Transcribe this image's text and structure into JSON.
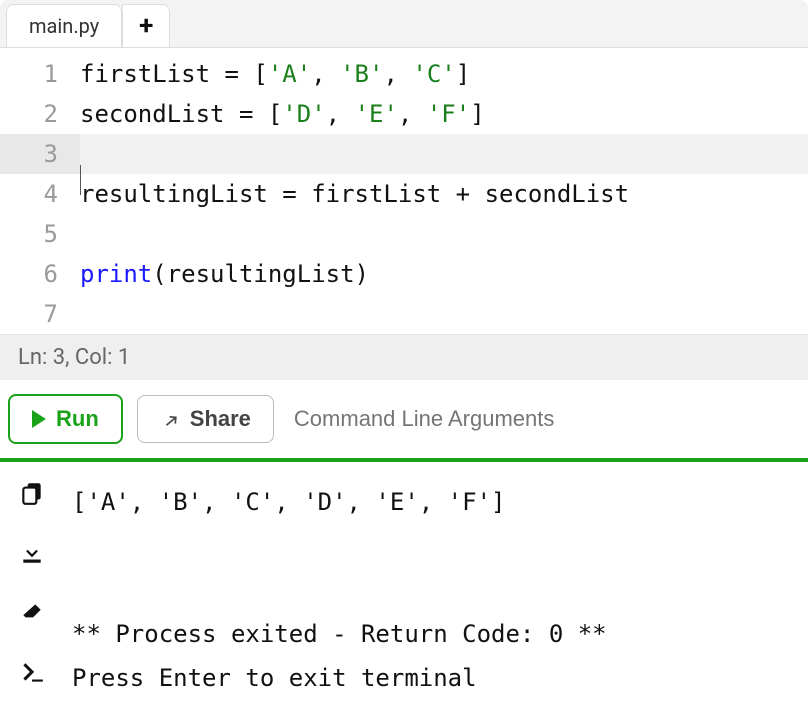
{
  "tabs": {
    "active": "main.py"
  },
  "editor": {
    "lines": [
      {
        "n": 1,
        "tokens": [
          {
            "t": "firstList = ["
          },
          {
            "t": "'A'",
            "c": "tok-str"
          },
          {
            "t": ", "
          },
          {
            "t": "'B'",
            "c": "tok-str"
          },
          {
            "t": ", "
          },
          {
            "t": "'C'",
            "c": "tok-str"
          },
          {
            "t": "]"
          }
        ]
      },
      {
        "n": 2,
        "tokens": [
          {
            "t": "secondList = ["
          },
          {
            "t": "'D'",
            "c": "tok-str"
          },
          {
            "t": ", "
          },
          {
            "t": "'E'",
            "c": "tok-str"
          },
          {
            "t": ", "
          },
          {
            "t": "'F'",
            "c": "tok-str"
          },
          {
            "t": "]"
          }
        ]
      },
      {
        "n": 3,
        "current": true,
        "tokens": []
      },
      {
        "n": 4,
        "tokens": [
          {
            "t": "resultingList = firstList + secondList"
          }
        ]
      },
      {
        "n": 5,
        "tokens": []
      },
      {
        "n": 6,
        "tokens": [
          {
            "t": "print",
            "c": "tok-builtin"
          },
          {
            "t": "(resultingList)"
          }
        ]
      },
      {
        "n": 7,
        "tokens": []
      }
    ]
  },
  "status": {
    "text": "Ln: 3,  Col: 1"
  },
  "actions": {
    "run": "Run",
    "share": "Share",
    "cmd_placeholder": "Command Line Arguments"
  },
  "output": {
    "lines": [
      "['A', 'B', 'C', 'D', 'E', 'F']",
      "",
      "",
      "** Process exited - Return Code: 0 **",
      "Press Enter to exit terminal"
    ]
  }
}
